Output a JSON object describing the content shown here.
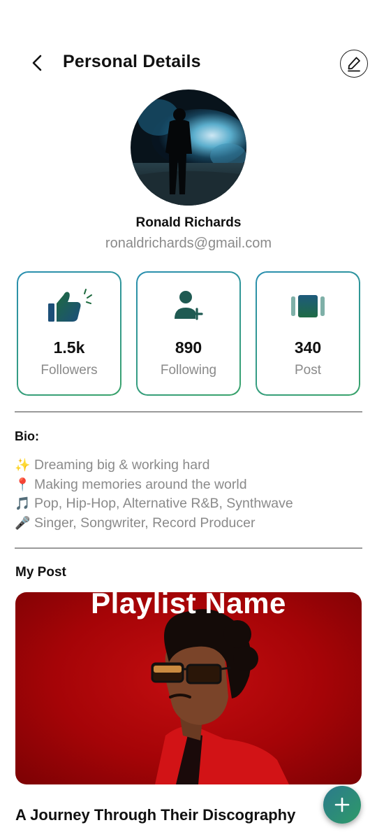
{
  "header": {
    "title": "Personal Details",
    "back_icon": "chevron-left-icon",
    "edit_icon": "pencil-icon"
  },
  "profile": {
    "name": "Ronald Richards",
    "email": "ronaldrichards@gmail.com"
  },
  "stats": [
    {
      "value": "1.5k",
      "label": "Followers",
      "icon": "thumbs-up-icon"
    },
    {
      "value": "890",
      "label": "Following",
      "icon": "add-user-icon"
    },
    {
      "value": "340",
      "label": "Post",
      "icon": "carousel-icon"
    }
  ],
  "bio": {
    "title": "Bio:",
    "lines": [
      {
        "emoji": "✨",
        "text": "Dreaming big & working hard"
      },
      {
        "emoji": "📍",
        "text": "Making memories around the world"
      },
      {
        "emoji": "🎵",
        "text": "Pop, Hip-Hop, Alternative R&B, Synthwave"
      },
      {
        "emoji": "🎤",
        "text": "Singer, Songwriter, Record Producer"
      }
    ]
  },
  "posts": {
    "title": "My Post",
    "items": [
      {
        "image_title": "Playlist Name",
        "caption": "A Journey Through Their Discography"
      }
    ]
  },
  "fab": {
    "icon": "plus-icon"
  },
  "colors": {
    "accent_teal": "#2b7a8c",
    "accent_green": "#2e9a68",
    "post_red": "#b0070a",
    "muted_text": "#8a8a8a"
  }
}
